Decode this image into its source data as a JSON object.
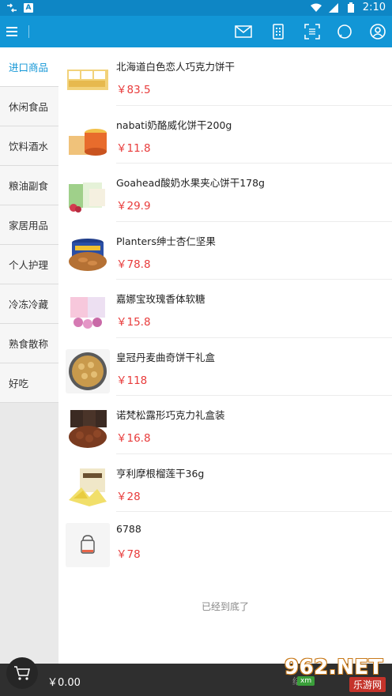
{
  "status_bar": {
    "time": "2:10",
    "a_badge": "A"
  },
  "app_bar": {
    "icons": [
      "menu-icon",
      "mail-icon",
      "list-icon",
      "scan-icon",
      "chat-icon",
      "user-icon"
    ]
  },
  "categories": [
    {
      "label": "进口商品",
      "active": true
    },
    {
      "label": "休闲食品",
      "active": false
    },
    {
      "label": "饮料酒水",
      "active": false
    },
    {
      "label": "粮油副食",
      "active": false
    },
    {
      "label": "家居用品",
      "active": false
    },
    {
      "label": "个人护理",
      "active": false
    },
    {
      "label": "冷冻冷藏",
      "active": false
    },
    {
      "label": "熟食散称",
      "active": false
    },
    {
      "label": "好吃",
      "active": false
    }
  ],
  "products": [
    {
      "name": "北海道白色恋人巧克力饼干",
      "price": "￥83.5"
    },
    {
      "name": "nabati奶酪威化饼干200g",
      "price": "￥11.8"
    },
    {
      "name": "Goahead酸奶水果夹心饼干178g",
      "price": "￥29.9"
    },
    {
      "name": "Planters绅士杏仁坚果",
      "price": "￥78.8"
    },
    {
      "name": "嘉娜宝玫瑰香体软糖",
      "price": "￥15.8"
    },
    {
      "name": "皇冠丹麦曲奇饼干礼盒",
      "price": "￥118"
    },
    {
      "name": "诺梵松露形巧克力礼盒装",
      "price": "￥16.8"
    },
    {
      "name": "亨利摩根榴莲干36g",
      "price": "￥28"
    },
    {
      "name": "6788",
      "price": "￥78"
    }
  ],
  "list_end_text": "已经到底了",
  "cart": {
    "total": "￥0.00",
    "label": "结算"
  },
  "watermark": {
    "main": "962.NET",
    "sub": "乐游网",
    "left": "xm"
  },
  "colors": {
    "primary": "#1296d6",
    "status_bar": "#0e86c5",
    "price": "#e83b3b",
    "bottom_bar": "#2f2f2f"
  }
}
